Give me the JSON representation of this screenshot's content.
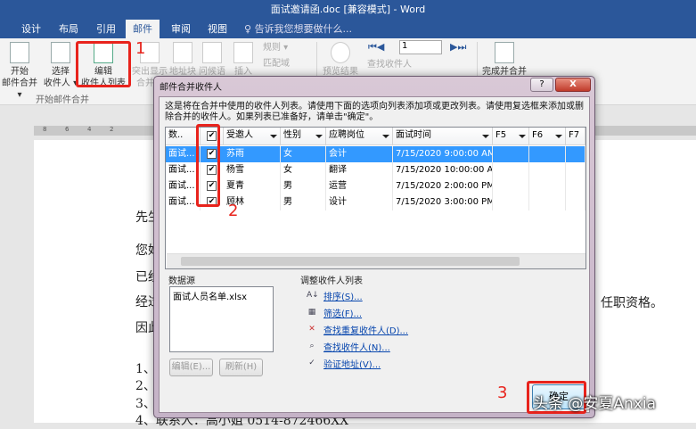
{
  "window": {
    "title": "面试邀请函.doc [兼容模式] - Word"
  },
  "tabs": [
    {
      "label": "设计"
    },
    {
      "label": "布局"
    },
    {
      "label": "引用"
    },
    {
      "label": "邮件"
    },
    {
      "label": "审阅"
    },
    {
      "label": "视图"
    }
  ],
  "tell_me": "告诉我您想要做什么...",
  "ribbon": {
    "start_merge": "开始",
    "start_merge2": "邮件合并 ▾",
    "select": "选择",
    "select2": "收件人 ▾",
    "edit": "编辑",
    "edit2": "收件人列表",
    "highlight": "突出显示",
    "highlight2": "合并域",
    "address": "地址块",
    "greeting": "问候语",
    "insert": "插入",
    "rules": "规则 ▾",
    "match": "匹配域",
    "preview": "预览结果",
    "record": "1",
    "find": "查找收件人",
    "finish": "完成并合并",
    "group_label": "开始邮件合并"
  },
  "ruler": [
    "8",
    "6",
    "4",
    "2"
  ],
  "document": {
    "lines": [
      "先生",
      "您好",
      "已经",
      "经过",
      "因此",
      "1、",
      "2、",
      "3、",
      "4、联系人：高小姐   0514-872466XX"
    ],
    "right_text": "任职资格。"
  },
  "dialog": {
    "title": "邮件合并收件人",
    "help": "?",
    "close": "X",
    "instructions": "这是将在合并中使用的收件人列表。请使用下面的选项向列表添加项或更改列表。请使用复选框来添加或删除合并的收件人。如果列表已准备好，请单击\"确定\"。",
    "columns": [
      "数..",
      "",
      "受邀人",
      "性别",
      "应聘岗位",
      "面试时间",
      "F5",
      "F6",
      "F7"
    ],
    "rows": [
      {
        "src": "面试...",
        "checked": true,
        "name": "苏雨",
        "gender": "女",
        "position": "会计",
        "time": "7/15/2020 9:00:00 AM"
      },
      {
        "src": "面试...",
        "checked": true,
        "name": "杨雪",
        "gender": "女",
        "position": "翻译",
        "time": "7/15/2020 10:00:00 A..."
      },
      {
        "src": "面试...",
        "checked": true,
        "name": "夏青",
        "gender": "男",
        "position": "运营",
        "time": "7/15/2020 2:00:00 PM"
      },
      {
        "src": "面试...",
        "checked": true,
        "name": "顾林",
        "gender": "男",
        "position": "设计",
        "time": "7/15/2020 3:00:00 PM"
      }
    ],
    "data_source_label": "数据源",
    "data_source_file": "面试人员名单.xlsx",
    "edit_button": "编辑(E)...",
    "refresh_button": "刷新(H)",
    "refine_label": "调整收件人列表",
    "links": [
      "排序(S)...",
      "筛选(F)...",
      "查找重复收件人(D)...",
      "查找收件人(N)...",
      "验证地址(V)..."
    ],
    "ok_button": "确定"
  },
  "annotations": [
    "1",
    "2",
    "3"
  ],
  "watermark": "头条 @安夏Anxia",
  "colors": {
    "word_blue": "#2b579a",
    "selection": "#3399ff",
    "annotation_red": "#e8231c"
  }
}
